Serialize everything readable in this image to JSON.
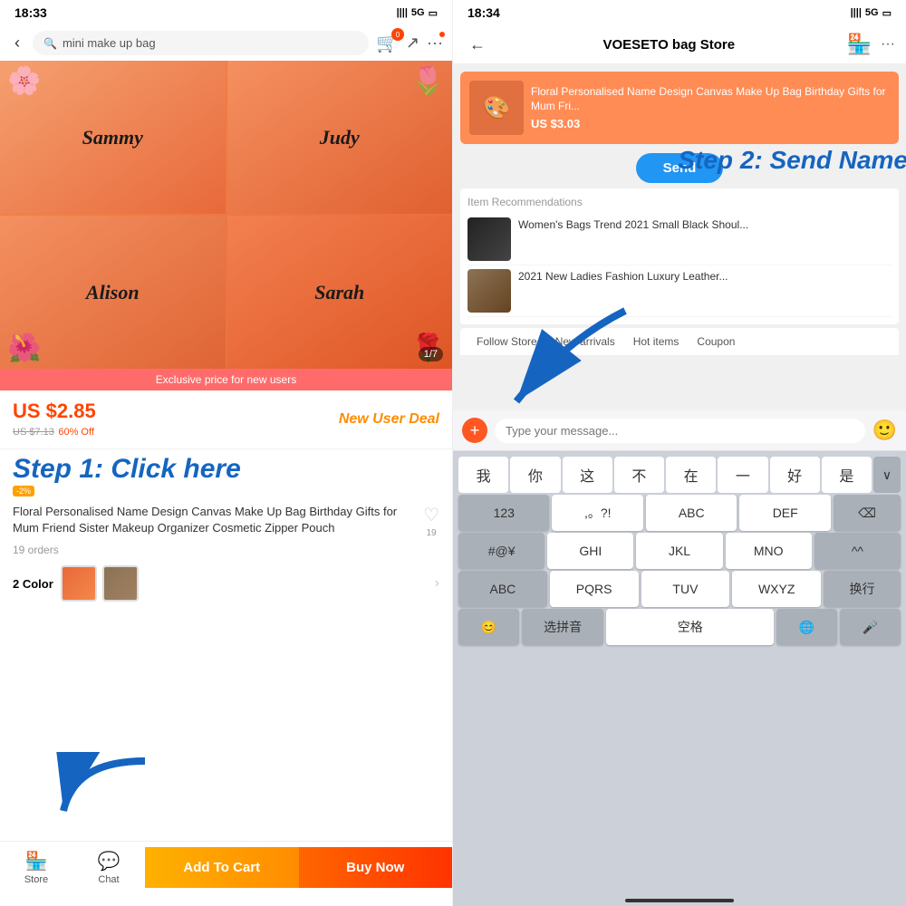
{
  "left": {
    "status": {
      "time": "18:33",
      "signal": "5G",
      "battery": "🔋"
    },
    "search": {
      "placeholder": "mini make up bag"
    },
    "product_image": {
      "counter": "1/7",
      "names": [
        "Sammy",
        "Judy",
        "Alison",
        "Sarah"
      ]
    },
    "exclusive_banner": "Exclusive price for new users",
    "price": {
      "main": "US $2.85",
      "original": "US $7.13",
      "discount": "60% Off",
      "deal_label": "New User\nDeal"
    },
    "step1_label": "Step 1: Click here",
    "cashback": "-2%",
    "product_title": "Floral Personalised Name Design Canvas Make Up Bag Birthday Gifts for Mum Friend Sister Makeup Organizer Cosmetic Zipper Pouch",
    "heart_count": "19",
    "orders": "19 orders",
    "color_section": {
      "label": "2 Color"
    },
    "nav": {
      "store_label": "Store",
      "chat_label": "Chat"
    },
    "add_cart_label": "Add To Cart",
    "buy_now_label": "Buy Now"
  },
  "right": {
    "status": {
      "time": "18:34",
      "signal": "5G"
    },
    "header": {
      "title": "VOESETO bag Store",
      "back": "←"
    },
    "product_card": {
      "name": "Floral Personalised Name Design Canvas Make Up Bag Birthday Gifts for Mum Fri...",
      "price": "US $3.03"
    },
    "send_btn_label": "Send",
    "step2_label": "Step 2: Send Name",
    "recommendation": {
      "title": "Item Recommendations",
      "items": [
        {
          "name": "Women's Bags Trend 2021 Small Black Shoul..."
        },
        {
          "name": "2021 New Ladies Fashion Luxury Leather..."
        }
      ]
    },
    "tabs": [
      "Follow Store",
      "New arrivals",
      "Hot items",
      "Coupon"
    ],
    "message_placeholder": "Type your message...",
    "keyboard": {
      "quick_words": [
        "我",
        "你",
        "这",
        "不",
        "在",
        "一",
        "好",
        "是"
      ],
      "row1": [
        "123",
        ",。?!",
        "ABC",
        "DEF"
      ],
      "row2": [
        "#@¥",
        "GHI",
        "JKL",
        "MNO",
        "^^"
      ],
      "row3": [
        "ABC",
        "PQRS",
        "TUV",
        "WXYZ"
      ],
      "row4_label": "换行",
      "pinyin_label": "选拼音",
      "space_label": "空格",
      "globe_icon": "🌐",
      "mic_icon": "🎤"
    }
  }
}
